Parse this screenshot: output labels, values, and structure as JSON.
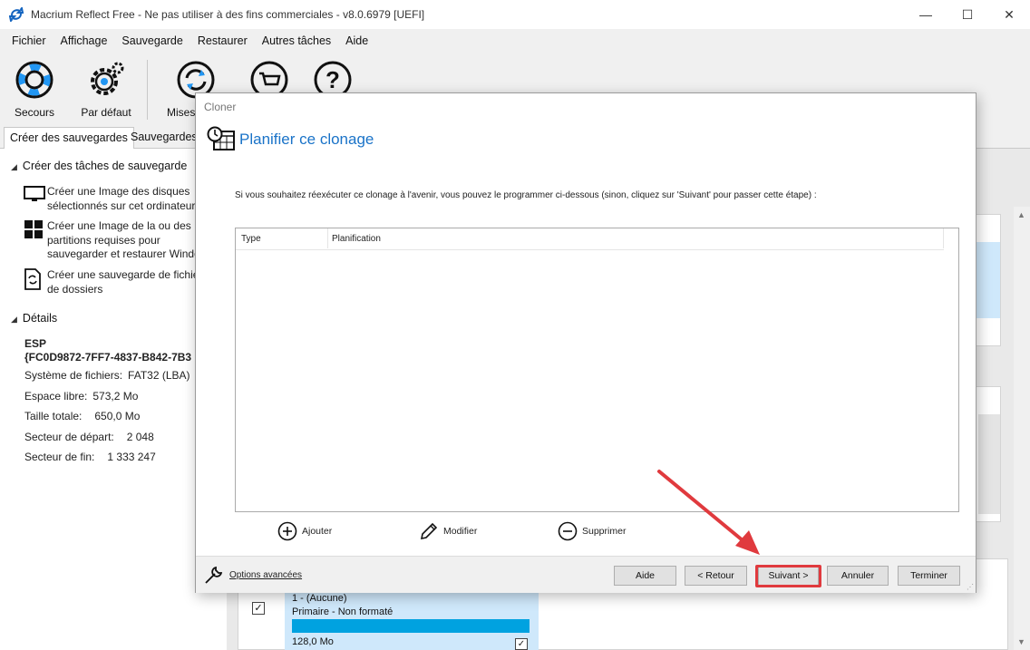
{
  "window": {
    "title": "Macrium Reflect Free - Ne pas utiliser à des fins commerciales - v8.0.6979  [UEFI]",
    "controls": {
      "minimize": "—",
      "maximize": "☐",
      "close": "✕"
    }
  },
  "menu": [
    "Fichier",
    "Affichage",
    "Sauvegarde",
    "Restaurer",
    "Autres tâches",
    "Aide"
  ],
  "toolbar": {
    "items": [
      {
        "label": "Secours",
        "icon": "lifebuoy-icon"
      },
      {
        "label": "Par défaut",
        "icon": "gear-icon"
      },
      {
        "label": "Mises",
        "icon": "update-icon"
      },
      {
        "label": "",
        "icon": "cart-icon"
      },
      {
        "label": "",
        "icon": "help-icon"
      }
    ]
  },
  "tabs": [
    "Créer des sauvegardes",
    "Sauvegardes"
  ],
  "leftpanel": {
    "create_section": "Créer des tâches de sauvegarde",
    "tasks": [
      {
        "lines": [
          "Créer une Image des disques",
          "sélectionnés sur cet ordinateur"
        ],
        "icon": "monitor-icon"
      },
      {
        "lines": [
          "Créer une Image de la ou des",
          "partitions requises pour",
          "sauvegarder et restaurer Windows"
        ],
        "icon": "windows-icon"
      },
      {
        "lines": [
          "Créer une sauvegarde de fichiers",
          "de dossiers"
        ],
        "icon": "file-backup-icon"
      }
    ],
    "details_section": "Détails",
    "details": {
      "name": "ESP",
      "guid": "{FC0D9872-7FF7-4837-B842-7B3",
      "rows": [
        {
          "label": "Système de fichiers:",
          "value": "FAT32 (LBA)"
        },
        {
          "label": "Espace libre:",
          "value": "573,2 Mo"
        },
        {
          "label": "Taille totale:",
          "value": "650,0 Mo"
        },
        {
          "label": "Secteur de départ:",
          "value": "2 048"
        },
        {
          "label": "Secteur de fin:",
          "value": "1 333 247"
        }
      ]
    }
  },
  "partition": {
    "line1": "1 -  (Aucune)",
    "line2": "Primaire - Non formaté",
    "line3": "128,0 Mo",
    "checked": "✓"
  },
  "dialog": {
    "title": "Cloner",
    "heading": "Planifier ce clonage",
    "instruction": "Si vous souhaitez réexécuter ce clonage à l'avenir, vous pouvez le programmer ci-dessous (sinon, cliquez sur 'Suivant' pour passer cette étape) :",
    "columns": [
      "Type",
      "Planification"
    ],
    "actions": {
      "add": "Ajouter",
      "edit": "Modifier",
      "delete": "Supprimer"
    },
    "footer": {
      "advanced": "Options avancées",
      "help": "Aide",
      "back": "< Retour",
      "next": "Suivant >",
      "cancel": "Annuler",
      "finish": "Terminer"
    }
  },
  "colors": {
    "accent": "#1a73c8",
    "highlight": "#e03a3e",
    "partition_bar": "#00a2e0",
    "selection": "#cfe8fb"
  }
}
